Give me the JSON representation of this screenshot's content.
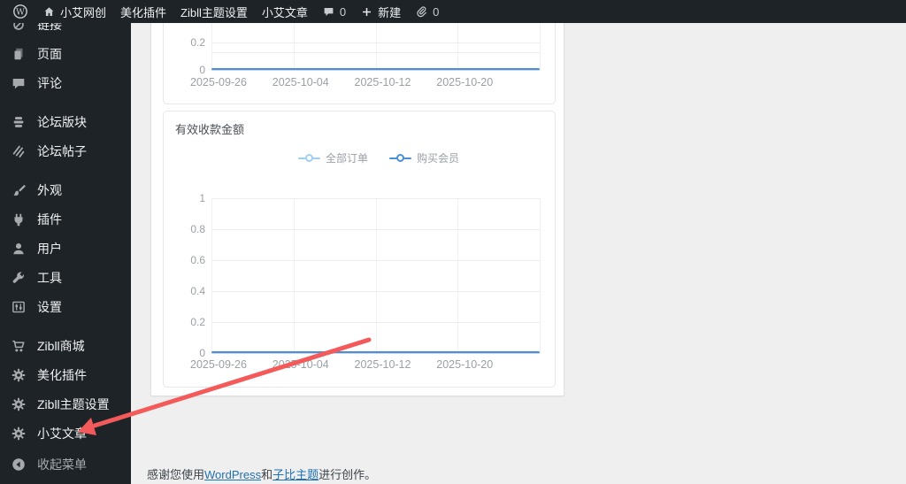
{
  "admin_bar": {
    "wordpress_logo": "wordpress-logo-icon",
    "site": {
      "slug": "site-name",
      "label": "小艾网创",
      "icon": "home-icon"
    },
    "menu_items": [
      {
        "slug": "beautify-plugin",
        "label": "美化插件"
      },
      {
        "slug": "zibll-theme-settings",
        "label": "Zibll主题设置"
      },
      {
        "slug": "xiaoai-article",
        "label": "小艾文章"
      }
    ],
    "comments": {
      "icon": "comment-bubble-icon",
      "count": "0"
    },
    "new_item": {
      "icon": "plus-icon",
      "label": "新建"
    },
    "links": {
      "icon": "paperclip-icon",
      "count": "0"
    }
  },
  "sidebar": {
    "items": [
      {
        "slug": "links",
        "label": "链接",
        "icon": "link-icon",
        "cut_by_admin_bar": true
      },
      {
        "slug": "pages",
        "label": "页面",
        "icon": "pages-icon"
      },
      {
        "slug": "comments",
        "label": "评论",
        "icon": "comments-icon"
      },
      {
        "type": "separator"
      },
      {
        "slug": "forums",
        "label": "论坛版块",
        "icon": "forums-icon"
      },
      {
        "slug": "topics",
        "label": "论坛帖子",
        "icon": "topics-icon"
      },
      {
        "type": "separator"
      },
      {
        "slug": "appearance",
        "label": "外观",
        "icon": "brush-icon"
      },
      {
        "slug": "plugins",
        "label": "插件",
        "icon": "plug-icon"
      },
      {
        "slug": "users",
        "label": "用户",
        "icon": "user-icon"
      },
      {
        "slug": "tools",
        "label": "工具",
        "icon": "wrench-icon"
      },
      {
        "slug": "settings",
        "label": "设置",
        "icon": "sliders-icon"
      },
      {
        "type": "separator"
      },
      {
        "slug": "zibll-shop",
        "label": "Zibll商城",
        "icon": "cart-icon"
      },
      {
        "slug": "beautify-plugin",
        "label": "美化插件",
        "icon": "gear-icon"
      },
      {
        "slug": "zibll-theme-settings",
        "label": "Zibll主题设置",
        "icon": "gear-icon"
      },
      {
        "slug": "xiaoai-article",
        "label": "小艾文章",
        "icon": "gear-icon"
      }
    ],
    "collapse": {
      "slug": "collapse-menu",
      "label": "收起菜单",
      "icon": "collapse-icon"
    }
  },
  "chart_data": [
    {
      "type": "line",
      "title": "",
      "note": "top chart, partially cut off by admin bar",
      "x": [
        "2025-09-26",
        "2025-10-04",
        "2025-10-12",
        "2025-10-20"
      ],
      "yticks": [
        "0.2",
        "0"
      ],
      "series": [
        {
          "name": "",
          "color": "#4a8fd9",
          "values": [
            0,
            0,
            0,
            0
          ]
        }
      ],
      "grid": true
    },
    {
      "type": "line",
      "title": "有效收款金额",
      "x": [
        "2025-09-26",
        "2025-10-04",
        "2025-10-12",
        "2025-10-20"
      ],
      "yticks": [
        "1",
        "0.8",
        "0.6",
        "0.4",
        "0.2",
        "0"
      ],
      "ylim": [
        0,
        1
      ],
      "legend_position": "top-center",
      "series": [
        {
          "name": "全部订单",
          "color": "#9fd0f3",
          "values": [
            0,
            0,
            0,
            0
          ]
        },
        {
          "name": "购买会员",
          "color": "#4a8fd9",
          "values": [
            0,
            0,
            0,
            0
          ]
        }
      ],
      "grid": true
    }
  ],
  "footer": {
    "prefix": "感谢您使用",
    "link1": "WordPress",
    "conj": "和",
    "link2": "子比主题",
    "suffix": "进行创作。"
  },
  "annotation": {
    "type": "arrow",
    "color": "#f45a5a",
    "points_to": "小艾文章"
  }
}
